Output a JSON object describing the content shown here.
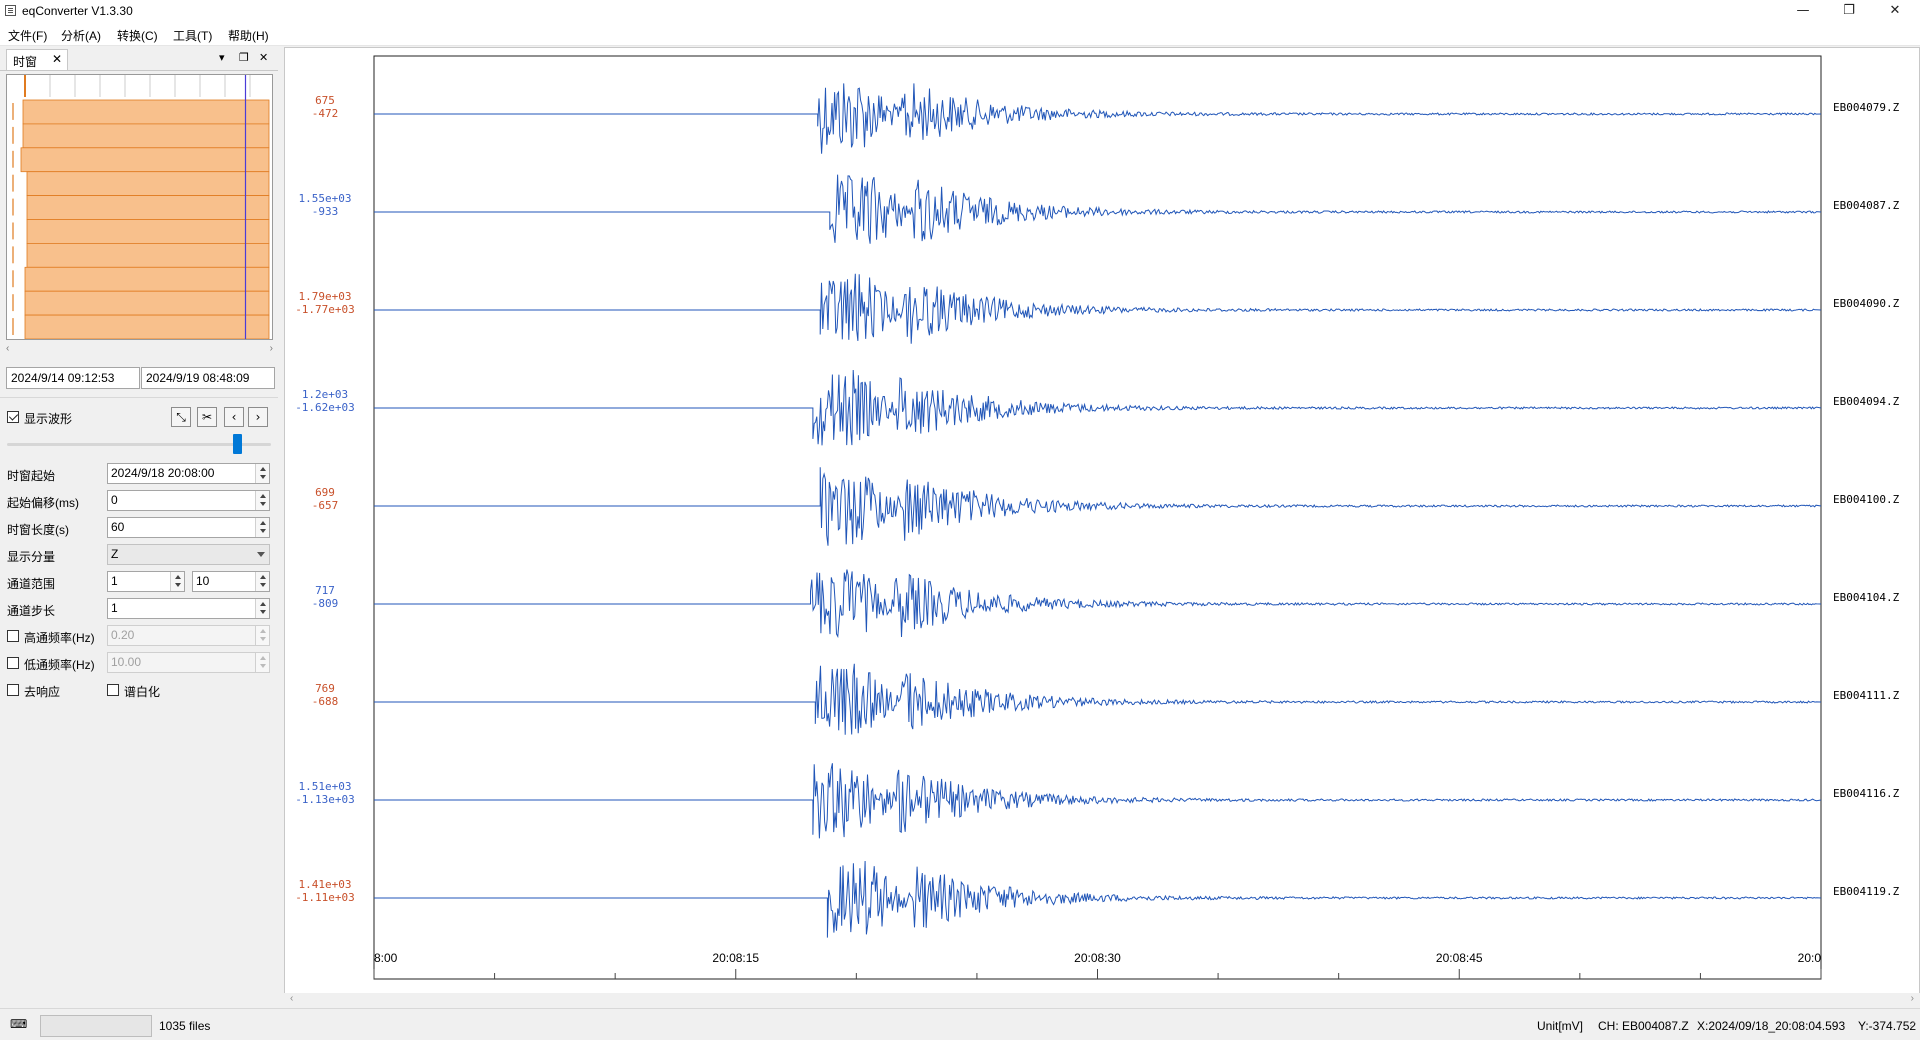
{
  "window": {
    "title": "eqConverter V1.3.30",
    "minimize": "—",
    "restore": "❐",
    "close": "✕"
  },
  "menu": [
    "文件(F)",
    "分析(A)",
    "转换(C)",
    "工具(T)",
    "帮助(H)"
  ],
  "panel": {
    "tab_label": "时窗",
    "tab_close": "✕",
    "overview": {
      "fill_color": "#f8c08c",
      "edge_color": "#e07b20",
      "cursor_color": "#4a3cd8",
      "row_count": 10
    },
    "date_start": "2024/9/14 09:12:53",
    "date_end": "2024/9/19 08:48:09",
    "show_waveform": {
      "label": "显示波形",
      "checked": true
    },
    "toolbar": {
      "fit_icon": "fit-icon",
      "cut_icon": "scissors-icon",
      "prev_icon": "chevron-left-icon",
      "next_icon": "chevron-right-icon"
    },
    "slider_value": 0.9,
    "window_start": {
      "label": "时窗起始",
      "value": "2024/9/18 20:08:00"
    },
    "offset": {
      "label": "起始偏移(ms)",
      "value": "0"
    },
    "length": {
      "label": "时窗长度(s)",
      "value": "60"
    },
    "component": {
      "label": "显示分量",
      "value": "Z"
    },
    "channel_range": {
      "label": "通道范围",
      "from": "1",
      "to": "10"
    },
    "channel_step": {
      "label": "通道步长",
      "value": "1"
    },
    "highpass": {
      "label": "高通频率(Hz)",
      "value": "0.20",
      "checked": false
    },
    "lowpass": {
      "label": "低通频率(Hz)",
      "value": "10.00",
      "checked": false
    },
    "deresponse": {
      "label": "去响应",
      "checked": false
    },
    "whitening": {
      "label": "谱白化",
      "checked": false
    }
  },
  "chart_data": {
    "type": "line",
    "line_color": "#2156b8",
    "x_unit": "seconds since 20:08:00",
    "x_range": [
      0,
      60
    ],
    "x_ticks": [
      "8:00",
      "20:08:15",
      "20:08:30",
      "20:08:45",
      "20:0"
    ],
    "onset_s": 18.5,
    "series": [
      {
        "name": "EB004079.Z",
        "max": "675",
        "min": "-472",
        "label_color": "#c8502a",
        "onset": 18.4
      },
      {
        "name": "EB004087.Z",
        "max": "1.55e+03",
        "min": "-933",
        "label_color": "#3a62c8",
        "onset": 18.9
      },
      {
        "name": "EB004090.Z",
        "max": "1.79e+03",
        "min": "-1.77e+03",
        "label_color": "#c8502a",
        "onset": 18.5
      },
      {
        "name": "EB004094.Z",
        "max": "1.2e+03",
        "min": "-1.62e+03",
        "label_color": "#3a62c8",
        "onset": 18.2
      },
      {
        "name": "EB004100.Z",
        "max": "699",
        "min": "-657",
        "label_color": "#c8502a",
        "onset": 18.5
      },
      {
        "name": "EB004104.Z",
        "max": "717",
        "min": "-809",
        "label_color": "#3a62c8",
        "onset": 18.1
      },
      {
        "name": "EB004111.Z",
        "max": "769",
        "min": "-688",
        "label_color": "#c8502a",
        "onset": 18.3
      },
      {
        "name": "EB004116.Z",
        "max": "1.51e+03",
        "min": "-1.13e+03",
        "label_color": "#3a62c8",
        "onset": 18.2
      },
      {
        "name": "EB004119.Z",
        "max": "1.41e+03",
        "min": "-1.11e+03",
        "label_color": "#c8502a",
        "onset": 18.8
      }
    ]
  },
  "status": {
    "menu_icon": "status-menu-icon",
    "files": "1035 files",
    "unit": "Unit[mV]",
    "channel": "CH: EB004087.Z",
    "x": "X:2024/09/18_20:08:04.593",
    "y": "Y:-374.752"
  }
}
